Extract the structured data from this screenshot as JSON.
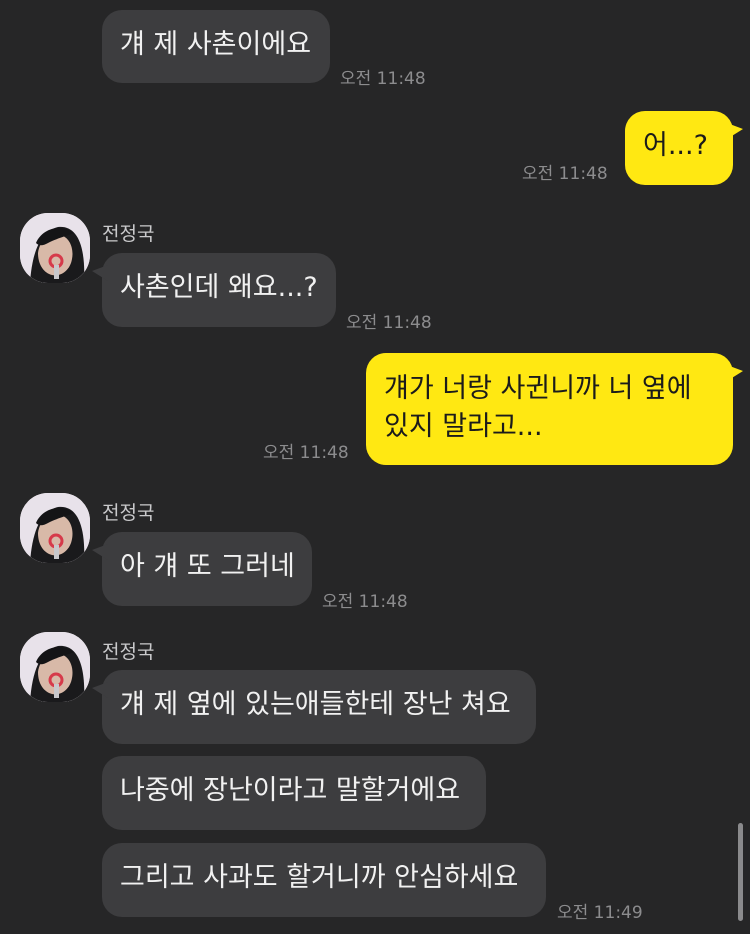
{
  "chat": {
    "contact_name": "전정국",
    "messages": [
      {
        "text": "걔 제 사촌이에요",
        "time": "오전 11:48"
      },
      {
        "text": "어...?",
        "time": "오전 11:48"
      },
      {
        "text": "사촌인데 왜요...?",
        "time": "오전 11:48"
      },
      {
        "line1": "걔가 너랑 사귄니까 너 옆에",
        "line2": "있지 말라고...",
        "time": "오전 11:48"
      },
      {
        "text": "아 걔 또 그러네",
        "time": "오전 11:48"
      },
      {
        "text": "걔 제 옆에 있는애들한테 장난 쳐요"
      },
      {
        "text": "나중에 장난이라고 말할거에요"
      },
      {
        "text": "그리고 사과도 할거니까 안심하세요",
        "time": "오전 11:49"
      }
    ]
  },
  "colors": {
    "background": "#262627",
    "incoming_bubble": "#3d3d3f",
    "outgoing_bubble": "#ffe812"
  },
  "icons": {
    "avatar": "profile-photo-icon"
  }
}
